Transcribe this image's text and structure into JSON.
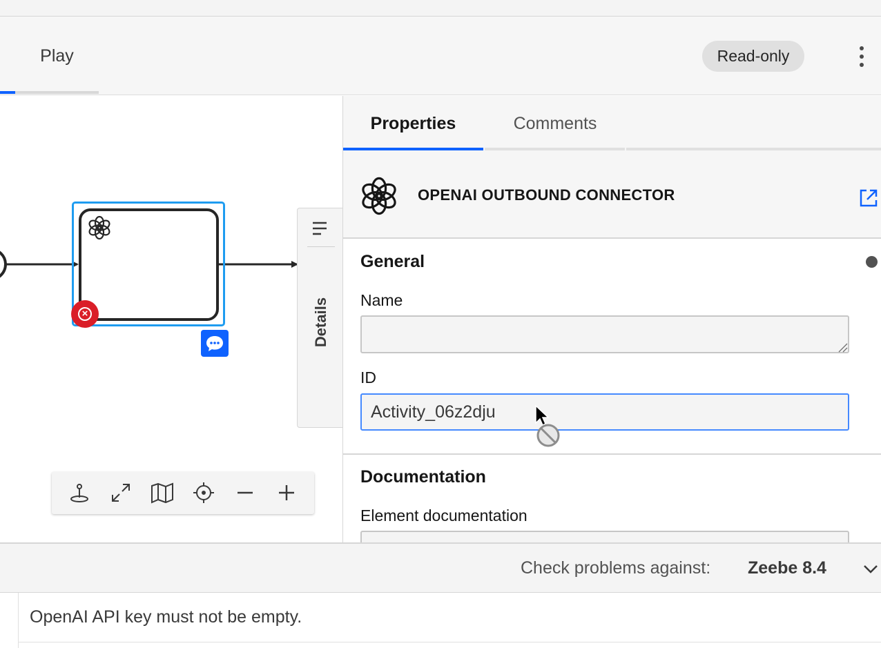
{
  "header": {
    "tab_play": "Play",
    "badge": "Read-only",
    "more_icon": "overflow-menu-vertical-icon"
  },
  "canvas": {
    "task_icon": "openai-icon",
    "error_icon": "error-icon",
    "comment_icon": "comment-icon",
    "details_label": "Details",
    "zoom_tools": [
      {
        "name": "reset-view-icon"
      },
      {
        "name": "fit-to-screen-icon"
      },
      {
        "name": "minimap-icon"
      },
      {
        "name": "center-icon"
      },
      {
        "name": "zoom-out-icon"
      },
      {
        "name": "zoom-in-icon"
      }
    ]
  },
  "properties_panel": {
    "tabs": [
      {
        "label": "Properties",
        "active": true
      },
      {
        "label": "Comments",
        "active": false
      }
    ],
    "element_title": "OPENAI OUTBOUND CONNECTOR",
    "element_icon": "openai-icon",
    "link_icon": "launch-icon",
    "general": {
      "title": "General",
      "name_label": "Name",
      "name_value": "",
      "id_label": "ID",
      "id_value": "Activity_06z2dju"
    },
    "documentation": {
      "title": "Documentation",
      "element_doc_label": "Element documentation"
    }
  },
  "problems": {
    "check_label": "Check problems against:",
    "engine": "Zeebe 8.4",
    "items": [
      "OpenAI API key must not be empty."
    ]
  },
  "colors": {
    "accent": "#0f62fe",
    "selection": "#1e9cf0",
    "error": "#da1e28"
  }
}
